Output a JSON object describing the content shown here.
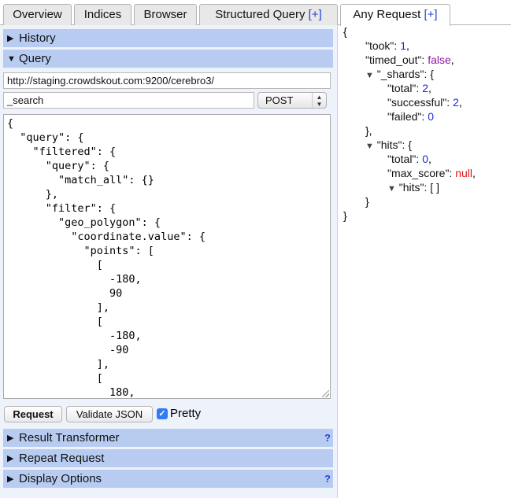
{
  "tabs": [
    {
      "label": "Overview"
    },
    {
      "label": "Indices"
    },
    {
      "label": "Browser"
    },
    {
      "label": "Structured Query",
      "plus": "[+]"
    },
    {
      "label": "Any Request",
      "plus": "[+]"
    }
  ],
  "sections": {
    "history": "History",
    "query": "Query",
    "result_transformer": "Result Transformer",
    "repeat_request": "Repeat Request",
    "display_options": "Display Options",
    "help": "?"
  },
  "query": {
    "url": "http://staging.crowdskout.com:9200/cerebro3/",
    "path": "_search",
    "method": "POST",
    "body": "{\n  \"query\": {\n    \"filtered\": {\n      \"query\": {\n        \"match_all\": {}\n      },\n      \"filter\": {\n        \"geo_polygon\": {\n          \"coordinate.value\": {\n            \"points\": [\n              [\n                -180,\n                90\n              ],\n              [\n                -180,\n                -90\n              ],\n              [\n                180,"
  },
  "buttons": {
    "request": "Request",
    "validate": "Validate JSON",
    "pretty": "Pretty",
    "pretty_checked": true
  },
  "icons": {
    "collapsed": "triangle-right-icon",
    "expanded": "triangle-down-icon",
    "checkbox": "checkmark-icon",
    "select_arrows": "up-down-arrows-icon"
  },
  "colors": {
    "section_bg": "#b8ccf2",
    "panel_bg": "#eef3fb",
    "number": "#1a2bd6",
    "boolean": "#8b1aa0",
    "null": "#e01414",
    "link": "#2244dd"
  },
  "response": {
    "open_brace": "{",
    "took_key": "\"took\": ",
    "took_val": "1",
    "timed_out_key": "\"timed_out\": ",
    "timed_out_val": "false",
    "shards_key": "\"_shards\": {",
    "total_key": "\"total\": ",
    "total_val": "2",
    "successful_key": "\"successful\": ",
    "successful_val": "2",
    "failed_key": "\"failed\": ",
    "failed_val": "0",
    "close_inner": "},",
    "hits_key": "\"hits\": {",
    "hits_total_key": "\"total\": ",
    "hits_total_val": "0",
    "max_score_key": "\"max_score\": ",
    "max_score_val": "null",
    "hits_arr_key": "\"hits\": [ ]",
    "close_hits": "}",
    "close_brace": "}"
  }
}
